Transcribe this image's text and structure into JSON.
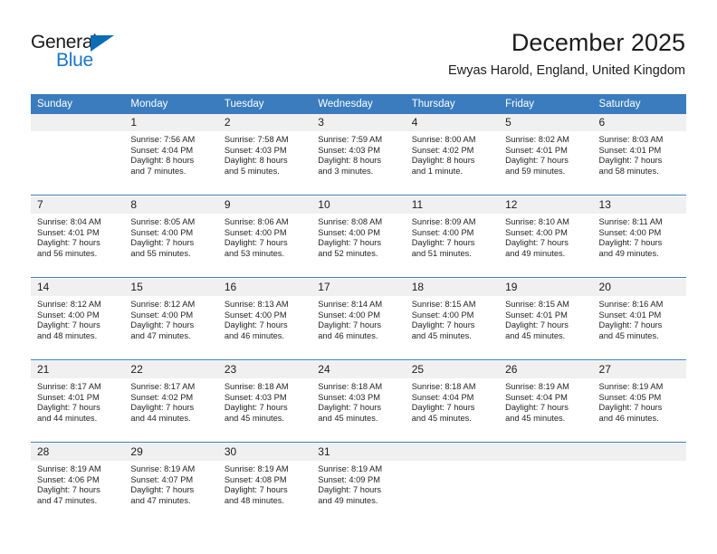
{
  "logo": {
    "word_one": "General",
    "word_two": "Blue",
    "triangle_color": "#0d6cb4",
    "blue_text_color": "#1877c7"
  },
  "header": {
    "title": "December 2025",
    "subtitle": "Ewyas Harold, England, United Kingdom"
  },
  "theme": {
    "header_blue": "#3a7cbe",
    "daynum_band": "#f0f0f0",
    "text": "#242424"
  },
  "calendar": {
    "weekday_headers": [
      "Sunday",
      "Monday",
      "Tuesday",
      "Wednesday",
      "Thursday",
      "Friday",
      "Saturday"
    ],
    "weeks": [
      {
        "days": [
          {
            "num": "",
            "sunrise": "",
            "sunset": "",
            "daylight_1": "",
            "daylight_2": ""
          },
          {
            "num": "1",
            "sunrise": "Sunrise: 7:56 AM",
            "sunset": "Sunset: 4:04 PM",
            "daylight_1": "Daylight: 8 hours",
            "daylight_2": "and 7 minutes."
          },
          {
            "num": "2",
            "sunrise": "Sunrise: 7:58 AM",
            "sunset": "Sunset: 4:03 PM",
            "daylight_1": "Daylight: 8 hours",
            "daylight_2": "and 5 minutes."
          },
          {
            "num": "3",
            "sunrise": "Sunrise: 7:59 AM",
            "sunset": "Sunset: 4:03 PM",
            "daylight_1": "Daylight: 8 hours",
            "daylight_2": "and 3 minutes."
          },
          {
            "num": "4",
            "sunrise": "Sunrise: 8:00 AM",
            "sunset": "Sunset: 4:02 PM",
            "daylight_1": "Daylight: 8 hours",
            "daylight_2": "and 1 minute."
          },
          {
            "num": "5",
            "sunrise": "Sunrise: 8:02 AM",
            "sunset": "Sunset: 4:01 PM",
            "daylight_1": "Daylight: 7 hours",
            "daylight_2": "and 59 minutes."
          },
          {
            "num": "6",
            "sunrise": "Sunrise: 8:03 AM",
            "sunset": "Sunset: 4:01 PM",
            "daylight_1": "Daylight: 7 hours",
            "daylight_2": "and 58 minutes."
          }
        ]
      },
      {
        "days": [
          {
            "num": "7",
            "sunrise": "Sunrise: 8:04 AM",
            "sunset": "Sunset: 4:01 PM",
            "daylight_1": "Daylight: 7 hours",
            "daylight_2": "and 56 minutes."
          },
          {
            "num": "8",
            "sunrise": "Sunrise: 8:05 AM",
            "sunset": "Sunset: 4:00 PM",
            "daylight_1": "Daylight: 7 hours",
            "daylight_2": "and 55 minutes."
          },
          {
            "num": "9",
            "sunrise": "Sunrise: 8:06 AM",
            "sunset": "Sunset: 4:00 PM",
            "daylight_1": "Daylight: 7 hours",
            "daylight_2": "and 53 minutes."
          },
          {
            "num": "10",
            "sunrise": "Sunrise: 8:08 AM",
            "sunset": "Sunset: 4:00 PM",
            "daylight_1": "Daylight: 7 hours",
            "daylight_2": "and 52 minutes."
          },
          {
            "num": "11",
            "sunrise": "Sunrise: 8:09 AM",
            "sunset": "Sunset: 4:00 PM",
            "daylight_1": "Daylight: 7 hours",
            "daylight_2": "and 51 minutes."
          },
          {
            "num": "12",
            "sunrise": "Sunrise: 8:10 AM",
            "sunset": "Sunset: 4:00 PM",
            "daylight_1": "Daylight: 7 hours",
            "daylight_2": "and 49 minutes."
          },
          {
            "num": "13",
            "sunrise": "Sunrise: 8:11 AM",
            "sunset": "Sunset: 4:00 PM",
            "daylight_1": "Daylight: 7 hours",
            "daylight_2": "and 49 minutes."
          }
        ]
      },
      {
        "days": [
          {
            "num": "14",
            "sunrise": "Sunrise: 8:12 AM",
            "sunset": "Sunset: 4:00 PM",
            "daylight_1": "Daylight: 7 hours",
            "daylight_2": "and 48 minutes."
          },
          {
            "num": "15",
            "sunrise": "Sunrise: 8:12 AM",
            "sunset": "Sunset: 4:00 PM",
            "daylight_1": "Daylight: 7 hours",
            "daylight_2": "and 47 minutes."
          },
          {
            "num": "16",
            "sunrise": "Sunrise: 8:13 AM",
            "sunset": "Sunset: 4:00 PM",
            "daylight_1": "Daylight: 7 hours",
            "daylight_2": "and 46 minutes."
          },
          {
            "num": "17",
            "sunrise": "Sunrise: 8:14 AM",
            "sunset": "Sunset: 4:00 PM",
            "daylight_1": "Daylight: 7 hours",
            "daylight_2": "and 46 minutes."
          },
          {
            "num": "18",
            "sunrise": "Sunrise: 8:15 AM",
            "sunset": "Sunset: 4:00 PM",
            "daylight_1": "Daylight: 7 hours",
            "daylight_2": "and 45 minutes."
          },
          {
            "num": "19",
            "sunrise": "Sunrise: 8:15 AM",
            "sunset": "Sunset: 4:01 PM",
            "daylight_1": "Daylight: 7 hours",
            "daylight_2": "and 45 minutes."
          },
          {
            "num": "20",
            "sunrise": "Sunrise: 8:16 AM",
            "sunset": "Sunset: 4:01 PM",
            "daylight_1": "Daylight: 7 hours",
            "daylight_2": "and 45 minutes."
          }
        ]
      },
      {
        "days": [
          {
            "num": "21",
            "sunrise": "Sunrise: 8:17 AM",
            "sunset": "Sunset: 4:01 PM",
            "daylight_1": "Daylight: 7 hours",
            "daylight_2": "and 44 minutes."
          },
          {
            "num": "22",
            "sunrise": "Sunrise: 8:17 AM",
            "sunset": "Sunset: 4:02 PM",
            "daylight_1": "Daylight: 7 hours",
            "daylight_2": "and 44 minutes."
          },
          {
            "num": "23",
            "sunrise": "Sunrise: 8:18 AM",
            "sunset": "Sunset: 4:03 PM",
            "daylight_1": "Daylight: 7 hours",
            "daylight_2": "and 45 minutes."
          },
          {
            "num": "24",
            "sunrise": "Sunrise: 8:18 AM",
            "sunset": "Sunset: 4:03 PM",
            "daylight_1": "Daylight: 7 hours",
            "daylight_2": "and 45 minutes."
          },
          {
            "num": "25",
            "sunrise": "Sunrise: 8:18 AM",
            "sunset": "Sunset: 4:04 PM",
            "daylight_1": "Daylight: 7 hours",
            "daylight_2": "and 45 minutes."
          },
          {
            "num": "26",
            "sunrise": "Sunrise: 8:19 AM",
            "sunset": "Sunset: 4:04 PM",
            "daylight_1": "Daylight: 7 hours",
            "daylight_2": "and 45 minutes."
          },
          {
            "num": "27",
            "sunrise": "Sunrise: 8:19 AM",
            "sunset": "Sunset: 4:05 PM",
            "daylight_1": "Daylight: 7 hours",
            "daylight_2": "and 46 minutes."
          }
        ]
      },
      {
        "days": [
          {
            "num": "28",
            "sunrise": "Sunrise: 8:19 AM",
            "sunset": "Sunset: 4:06 PM",
            "daylight_1": "Daylight: 7 hours",
            "daylight_2": "and 47 minutes."
          },
          {
            "num": "29",
            "sunrise": "Sunrise: 8:19 AM",
            "sunset": "Sunset: 4:07 PM",
            "daylight_1": "Daylight: 7 hours",
            "daylight_2": "and 47 minutes."
          },
          {
            "num": "30",
            "sunrise": "Sunrise: 8:19 AM",
            "sunset": "Sunset: 4:08 PM",
            "daylight_1": "Daylight: 7 hours",
            "daylight_2": "and 48 minutes."
          },
          {
            "num": "31",
            "sunrise": "Sunrise: 8:19 AM",
            "sunset": "Sunset: 4:09 PM",
            "daylight_1": "Daylight: 7 hours",
            "daylight_2": "and 49 minutes."
          },
          {
            "num": "",
            "sunrise": "",
            "sunset": "",
            "daylight_1": "",
            "daylight_2": ""
          },
          {
            "num": "",
            "sunrise": "",
            "sunset": "",
            "daylight_1": "",
            "daylight_2": ""
          },
          {
            "num": "",
            "sunrise": "",
            "sunset": "",
            "daylight_1": "",
            "daylight_2": ""
          }
        ]
      }
    ]
  }
}
